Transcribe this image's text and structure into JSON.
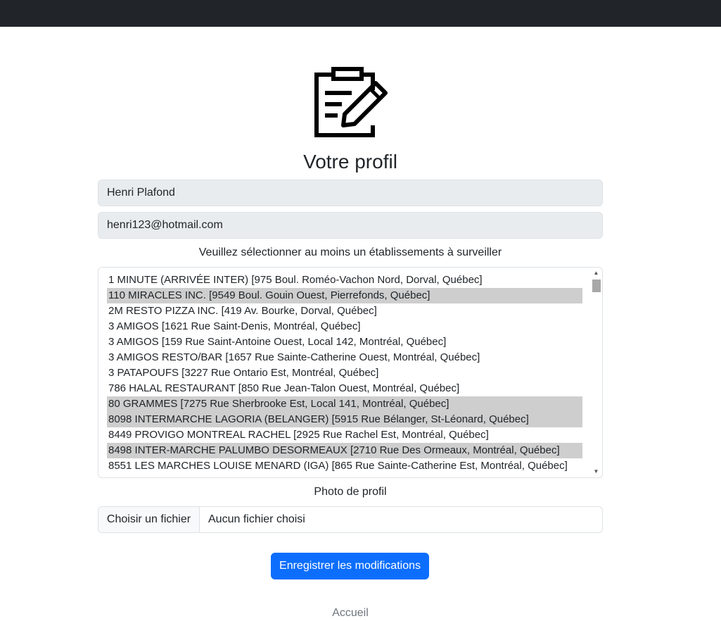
{
  "page": {
    "title": "Votre profil",
    "icon": "clipboard-edit-icon"
  },
  "form": {
    "name_value": "Henri Plafond",
    "email_value": "henri123@hotmail.com",
    "select_label": "Veuillez sélectionner au moins un établissements à surveiller",
    "establishments": [
      {
        "label": "1 MINUTE (ARRIVÉE INTER) [975 Boul. Roméo-Vachon Nord, Dorval, Québec]",
        "selected": false
      },
      {
        "label": "110 MIRACLES INC. [9549 Boul. Gouin Ouest, Pierrefonds, Québec]",
        "selected": true
      },
      {
        "label": "2M RESTO PIZZA INC. [419 Av. Bourke, Dorval, Québec]",
        "selected": false
      },
      {
        "label": "3 AMIGOS [1621 Rue Saint-Denis, Montréal, Québec]",
        "selected": false
      },
      {
        "label": "3 AMIGOS [159 Rue Saint-Antoine Ouest, Local 142, Montréal, Québec]",
        "selected": false
      },
      {
        "label": "3 AMIGOS RESTO/BAR [1657 Rue Sainte-Catherine Ouest, Montréal, Québec]",
        "selected": false
      },
      {
        "label": "3 PATAPOUFS [3227 Rue Ontario Est, Montréal, Québec]",
        "selected": false
      },
      {
        "label": "786 HALAL RESTAURANT [850 Rue Jean-Talon Ouest, Montréal, Québec]",
        "selected": false
      },
      {
        "label": "80 GRAMMES [7275 Rue Sherbrooke Est, Local 141, Montréal, Québec]",
        "selected": true
      },
      {
        "label": "8098 INTERMARCHE LAGORIA (BELANGER) [5915 Rue Bélanger, St-Léonard, Québec]",
        "selected": true
      },
      {
        "label": "8449 PROVIGO MONTREAL RACHEL [2925 Rue Rachel Est, Montréal, Québec]",
        "selected": false
      },
      {
        "label": "8498 INTER-MARCHE PALUMBO DESORMEAUX [2710 Rue Des Ormeaux, Montréal, Québec]",
        "selected": true
      },
      {
        "label": "8551 LES MARCHES LOUISE MENARD (IGA) [865 Rue Sainte-Catherine Est, Montréal, Québec]",
        "selected": false
      }
    ],
    "photo_label": "Photo de profil",
    "file_button_label": "Choisir un fichier",
    "file_status": "Aucun fichier choisi",
    "save_label": "Enregistrer les modifications"
  },
  "footer": {
    "home_link": "Accueil"
  },
  "colors": {
    "topbar": "#212529",
    "primary": "#0d6efd",
    "field_bg": "#e9ecef",
    "selected_option": "#cecece"
  }
}
